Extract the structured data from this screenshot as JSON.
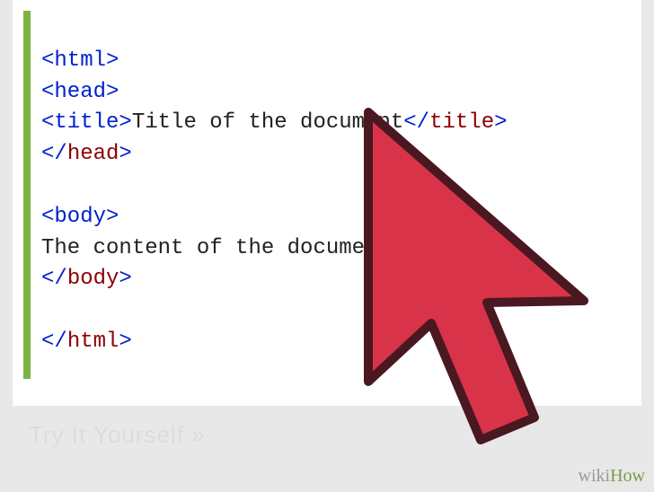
{
  "code": {
    "line1": {
      "tag": "html"
    },
    "line2": {
      "tag": "head"
    },
    "line3": {
      "openTag": "title",
      "text": "Title of the document",
      "closeTag": "title"
    },
    "line4": {
      "closeTag": "head"
    },
    "line5": "",
    "line6": {
      "tag": "body"
    },
    "line7": {
      "text": "The content of the document......"
    },
    "line8": {
      "closeTag": "body"
    },
    "line9": "",
    "line10": {
      "closeTag": "html"
    }
  },
  "watermark": {
    "part1": "wiki",
    "part2": "How"
  },
  "faint": "Try It Yourself »"
}
